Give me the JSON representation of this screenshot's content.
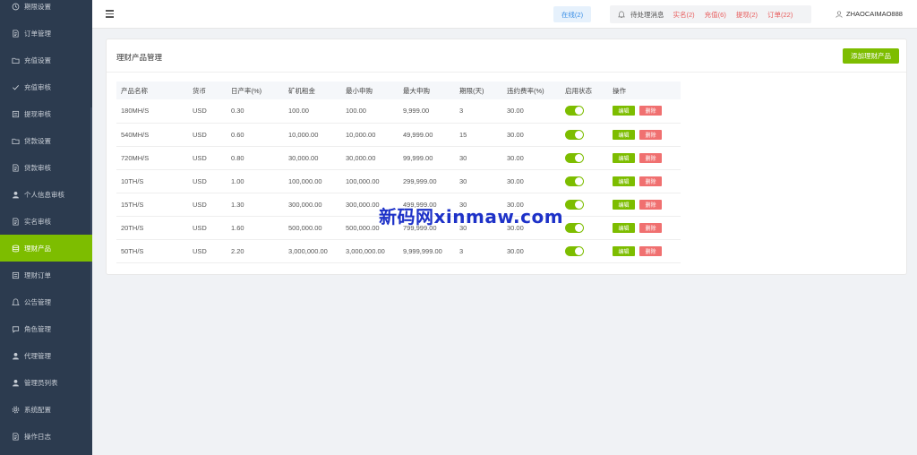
{
  "sidebar": {
    "items": [
      {
        "label": "期限设置",
        "icon": "clock-icon",
        "active": false
      },
      {
        "label": "订单管理",
        "icon": "document-icon",
        "active": false
      },
      {
        "label": "充值设置",
        "icon": "folder-icon",
        "active": false
      },
      {
        "label": "充值审核",
        "icon": "check-icon",
        "active": false
      },
      {
        "label": "提现审核",
        "icon": "list-icon",
        "active": false
      },
      {
        "label": "贷款设置",
        "icon": "folder-icon",
        "active": false
      },
      {
        "label": "贷款审核",
        "icon": "document-icon",
        "active": false
      },
      {
        "label": "个人信息审核",
        "icon": "user-icon",
        "active": false
      },
      {
        "label": "实名审核",
        "icon": "document-icon",
        "active": false
      },
      {
        "label": "理财产品",
        "icon": "database-icon",
        "active": true
      },
      {
        "label": "理财订单",
        "icon": "list-icon",
        "active": false
      },
      {
        "label": "公告管理",
        "icon": "bell-icon",
        "active": false
      },
      {
        "label": "角色管理",
        "icon": "chat-icon",
        "active": false
      },
      {
        "label": "代理管理",
        "icon": "user-icon",
        "active": false
      },
      {
        "label": "管理员列表",
        "icon": "user-icon",
        "active": false
      },
      {
        "label": "系统配置",
        "icon": "gear-icon",
        "active": false
      },
      {
        "label": "操作日志",
        "icon": "document-icon",
        "active": false
      }
    ]
  },
  "topbar": {
    "online": "在线(2)",
    "pending_label": "待处理消息",
    "counts": [
      "实名(2)",
      "充值(6)",
      "提现(2)",
      "订单(22)"
    ],
    "username": "ZHAOCAIMAO888"
  },
  "card": {
    "title": "理财产品管理",
    "add_button": "添加理财产品"
  },
  "table": {
    "headers": [
      "产品名称",
      "货币",
      "日产率(%)",
      "矿机租金",
      "最小申购",
      "最大申购",
      "期限(天)",
      "违约费率(%)",
      "启用状态",
      "操作"
    ],
    "edit_label": "编辑",
    "delete_label": "删除",
    "rows": [
      {
        "name": "180MH/S",
        "currency": "USD",
        "rate": "0.30",
        "rent": "100.00",
        "min": "100.00",
        "max": "9,999.00",
        "days": "3",
        "penalty": "30.00",
        "enabled": true
      },
      {
        "name": "540MH/S",
        "currency": "USD",
        "rate": "0.60",
        "rent": "10,000.00",
        "min": "10,000.00",
        "max": "49,999.00",
        "days": "15",
        "penalty": "30.00",
        "enabled": true
      },
      {
        "name": "720MH/S",
        "currency": "USD",
        "rate": "0.80",
        "rent": "30,000.00",
        "min": "30,000.00",
        "max": "99,999.00",
        "days": "30",
        "penalty": "30.00",
        "enabled": true
      },
      {
        "name": "10TH/S",
        "currency": "USD",
        "rate": "1.00",
        "rent": "100,000.00",
        "min": "100,000.00",
        "max": "299,999.00",
        "days": "30",
        "penalty": "30.00",
        "enabled": true
      },
      {
        "name": "15TH/S",
        "currency": "USD",
        "rate": "1.30",
        "rent": "300,000.00",
        "min": "300,000.00",
        "max": "499,999.00",
        "days": "30",
        "penalty": "30.00",
        "enabled": true
      },
      {
        "name": "20TH/S",
        "currency": "USD",
        "rate": "1.60",
        "rent": "500,000.00",
        "min": "500,000.00",
        "max": "799,999.00",
        "days": "30",
        "penalty": "30.00",
        "enabled": true
      },
      {
        "name": "50TH/S",
        "currency": "USD",
        "rate": "2.20",
        "rent": "3,000,000.00",
        "min": "3,000,000.00",
        "max": "9,999,999.00",
        "days": "3",
        "penalty": "30.00",
        "enabled": true
      }
    ]
  },
  "watermark": "新码网xinmaw.com",
  "colors": {
    "sidebar_bg": "#2c3b4f",
    "accent_green": "#7dbd00",
    "danger_red": "#f07070",
    "badge_blue": "#3a8ee6"
  }
}
